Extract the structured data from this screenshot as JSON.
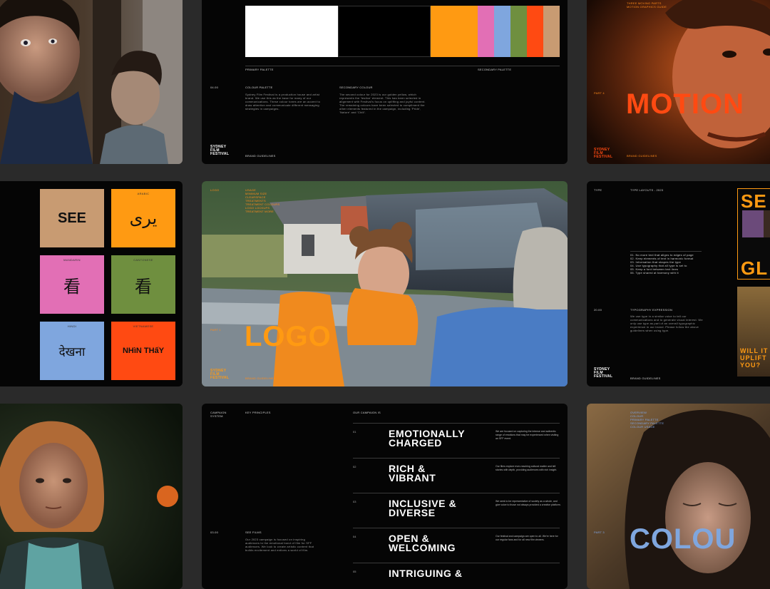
{
  "colors": {
    "orange": "#ff9a12",
    "pink": "#e26fb5",
    "blue": "#7fa6de",
    "olive": "#6f8f3f",
    "red": "#ff4a12",
    "tan": "#c89b72",
    "black": "#050505"
  },
  "brand_logo": [
    "SYDNEY",
    "FILM",
    "FESTIVAL"
  ],
  "footer_label": "BRAND GUIDELINES",
  "palette_slide": {
    "primary_label": "PRIMARY PALETTE",
    "secondary_label": "SECONDARY PALETTE",
    "section_no": "04.00",
    "section_title": "COLOUR PALETTE",
    "body": "Sydney Film Festival is a production house and artist brand. We use this as the base for many of our communications. These colour tones are an accent to draw attention and communicate different messaging strategies in campaigns.",
    "secondary_title": "SECONDARY COLOUR",
    "secondary_body": "The second colour for 2023 is our golden yellow, which represents the 'festive' element. This has been selected in alignment with Festival's focus on uplifting and joyful content. The remaining colours have been selected to compliment the other elements featured in the campaign, including 'Pride', 'Nature' and 'Chill'."
  },
  "motion_slide": {
    "title": "MOTION",
    "part": "PART 4",
    "header_lines": [
      "THREE MOVING PARTS",
      "MOTION GRAPHICS GUIDE"
    ]
  },
  "see_slide": {
    "squares": [
      {
        "caption": "",
        "glyph": "SEE",
        "color": "#c89b72"
      },
      {
        "caption": "ARABIC",
        "glyph": "یری",
        "color": "#ff9a12"
      },
      {
        "caption": "MANDARIN",
        "glyph": "看",
        "color": "#e26fb5"
      },
      {
        "caption": "CANTONESE",
        "glyph": "看",
        "color": "#6f8f3f"
      },
      {
        "caption": "HINDI",
        "glyph": "देखना",
        "color": "#7fa6de"
      },
      {
        "caption": "VIETNAMESE",
        "glyph": "NHìN THấY",
        "color": "#ff4a12"
      }
    ]
  },
  "logo_slide": {
    "title": "LOGO",
    "part": "PART 1",
    "tag": "LOGO",
    "menu": [
      "USAGE",
      "MINIMUM SIZE",
      "CLEARSPACE",
      "TREATMENTS",
      "TREATMENT COLOURS",
      "LOGO LOCKUPS",
      "TREATMENT MORE"
    ]
  },
  "type_slide": {
    "col1": "TYPE",
    "col2": "TYPE LAYOUTS - 2023",
    "list": [
      "01. No more text that aligns to edges of page",
      "02. Keep elements of text in harmonic format",
      "03. Information that shapes the type",
      "04. Use typography that all type is set to",
      "05. Keep a font between text lines",
      "06. Type shared at harmony with it"
    ],
    "section_no": "20.00",
    "section_title": "TYPOGRAPHY EXPRESSION",
    "body": "We use type in a similar voice to tell our communications and to generate visual interest. We only use type as part of an overall typographic experience in our brand. Please follow the above guidelines when using type.",
    "poster_lines": [
      "SE",
      "GL"
    ],
    "poster2_lines": [
      "WILL IT",
      "UPLIFT",
      "YOU?"
    ]
  },
  "principles_slide": {
    "col1": [
      "CAMPAIGN",
      "SYSTEM"
    ],
    "col2": "KEY PRINCIPLES",
    "col3": "OUR CAMPAIGN IS",
    "section_no": "03.00",
    "section_title": "SEE FILMS",
    "body": "Our 2023 campaign is focused on inspiring audiences to the emotional bond of film for SFF audiences. We look to create artistic content that builds excitement and entices a world of film.",
    "items": [
      {
        "no": "01",
        "title": [
          "EMOTIONALLY",
          "CHARGED"
        ],
        "desc": "We are focused on capturing the intense and authentic range of emotions that may be experienced when visiting an SFF event."
      },
      {
        "no": "02",
        "title": [
          "RICH &",
          "VIBRANT"
        ],
        "desc": "Our films explore ever-reaching cultural matter and tell stories with depth, providing audiences with rich insight."
      },
      {
        "no": "03",
        "title": [
          "INCLUSIVE &",
          "DIVERSE"
        ],
        "desc": "We seek to be representative of society as a whole, and give voice to those not always provided a creative platform."
      },
      {
        "no": "04",
        "title": [
          "OPEN &",
          "WELCOMING"
        ],
        "desc": "Our festival and campaign are open to all. We're here for our regular fans and for all new film viewers."
      },
      {
        "no": "05",
        "title": [
          "INTRIGUING &",
          ""
        ],
        "desc": ""
      }
    ]
  },
  "colour_slide": {
    "title": "COLOU",
    "part": "PART 3",
    "menu": [
      "OVERVIEW",
      "COLOUR",
      "PRIMARY PALETTE",
      "SECONDARY PALETTE",
      "COLOUR USAGE"
    ]
  }
}
